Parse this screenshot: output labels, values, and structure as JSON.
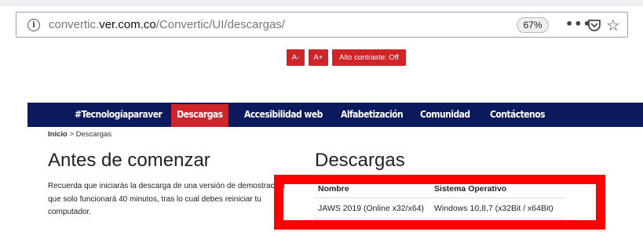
{
  "browser": {
    "url_prefix": "convertic.",
    "url_host": "ver.com.co",
    "url_path": "/Convertic/UI/descargas/",
    "zoom": "67%",
    "menu_glyph": "•••",
    "star_glyph": "☆",
    "info_glyph": "i"
  },
  "accessibility": {
    "decrease_label": "A-",
    "increase_label": "A+",
    "contrast_label": "Alto contraste: Off"
  },
  "nav": {
    "items": [
      "#Tecnologíaparaver",
      "Descargas",
      "Accesibilidad web",
      "Alfabetización",
      "Comunidad",
      "Contáctenos"
    ],
    "active": "Descargas"
  },
  "breadcrumb": {
    "home": "Inicio",
    "separator": " > ",
    "current": "Descargas"
  },
  "intro": {
    "title": "Antes de comenzar",
    "text": "Recuerda que iniciarás la descarga de una versión de demostración que solo funcionará 40 minutos, tras lo cual debes reiniciar tu computador."
  },
  "downloads": {
    "title": "Descargas",
    "columns": [
      "Nombre",
      "Sistema Operativo"
    ],
    "rows": [
      [
        "JAWS 2019 (Online x32/x64)",
        "Windows 10,8,7 (x32Bit / x64Bit)"
      ]
    ]
  },
  "colors": {
    "nav_bg": "#0b1a5c",
    "accent_red": "#d0242b",
    "highlight": "#ff0000"
  },
  "icons": {
    "info": "info-icon",
    "menu": "more-options-icon",
    "pocket": "pocket-icon",
    "bookmark": "star-icon"
  }
}
